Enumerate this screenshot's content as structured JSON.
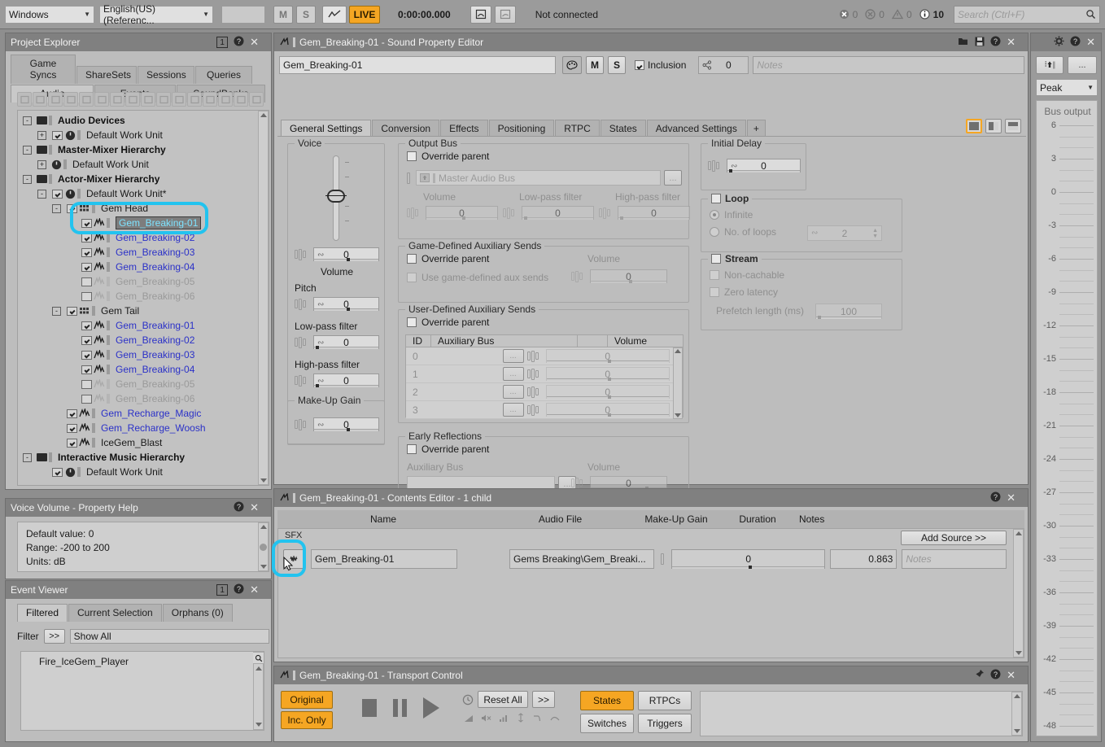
{
  "topbar": {
    "platform": "Windows",
    "language": "English(US) (Referenc...",
    "blank_field": "",
    "mute_label": "M",
    "solo_label": "S",
    "curve_icon": "waveform-icon",
    "live_label": "LIVE",
    "time": "0:00:00.000",
    "connect_icon": "remote-connect-icon",
    "connect_icon2": "remote-connect-alt-icon",
    "connection_status": "Not connected",
    "counters": [
      {
        "icon": "error-icon",
        "value": "0"
      },
      {
        "icon": "critical-icon",
        "value": "0"
      },
      {
        "icon": "warning-icon",
        "value": "0"
      },
      {
        "icon": "info-icon",
        "value": "10"
      }
    ],
    "search_placeholder": "Search (Ctrl+F)",
    "search_icon": "search-icon"
  },
  "project_explorer": {
    "title": "Project Explorer",
    "badge": "1",
    "help_icon": "help-icon",
    "close_icon": "close-icon",
    "tabs_row1": [
      "Game Syncs",
      "ShareSets",
      "Sessions",
      "Queries"
    ],
    "tabs_row2": [
      "Audio",
      "Events",
      "SoundBanks"
    ],
    "selected_tab": "Audio",
    "toolbar_icons": [
      "recent-icon",
      "new-folder-icon",
      "open-folder-icon",
      "mixer-icon",
      "grid-icon",
      "list-icon",
      "blend-icon",
      "random-icon",
      "sound-icon",
      "motion-icon",
      "bus-icon",
      "aux-bus-icon",
      "switch-icon",
      "actor-mixer-icon",
      "music-icon",
      "range-icon"
    ],
    "tree": [
      {
        "indent": 0,
        "expander": "-",
        "check": null,
        "icon": "folder-icon",
        "label": "Audio Devices",
        "style": "bold"
      },
      {
        "indent": 1,
        "expander": "+",
        "check": "on",
        "icon": "device-icon",
        "label": "Default Work Unit",
        "style": "normal"
      },
      {
        "indent": 0,
        "expander": "-",
        "check": null,
        "icon": "folder-icon",
        "label": "Master-Mixer Hierarchy",
        "style": "bold"
      },
      {
        "indent": 1,
        "expander": "+",
        "check": null,
        "icon": "device-icon",
        "label": "Default Work Unit",
        "style": "normal"
      },
      {
        "indent": 0,
        "expander": "-",
        "check": null,
        "icon": "folder-icon",
        "label": "Actor-Mixer Hierarchy",
        "style": "bold"
      },
      {
        "indent": 1,
        "expander": "-",
        "check": "on",
        "icon": "device-icon",
        "label": "Default Work Unit*",
        "style": "normal"
      },
      {
        "indent": 2,
        "expander": "-",
        "check": "on",
        "icon": "actormixer-icon",
        "label": "Gem Head",
        "style": "normal"
      },
      {
        "indent": 3,
        "expander": null,
        "check": "on",
        "icon": "sound-icon",
        "label": "Gem_Breaking-01",
        "style": "selected"
      },
      {
        "indent": 3,
        "expander": null,
        "check": "on",
        "icon": "sound-icon",
        "label": "Gem_Breaking-02",
        "style": "blue"
      },
      {
        "indent": 3,
        "expander": null,
        "check": "on",
        "icon": "sound-icon",
        "label": "Gem_Breaking-03",
        "style": "blue"
      },
      {
        "indent": 3,
        "expander": null,
        "check": "on",
        "icon": "sound-icon",
        "label": "Gem_Breaking-04",
        "style": "blue"
      },
      {
        "indent": 3,
        "expander": null,
        "check": "off",
        "icon": "sound-icon",
        "label": "Gem_Breaking-05",
        "style": "gray"
      },
      {
        "indent": 3,
        "expander": null,
        "check": "off",
        "icon": "sound-icon",
        "label": "Gem_Breaking-06",
        "style": "gray"
      },
      {
        "indent": 2,
        "expander": "-",
        "check": "on",
        "icon": "actormixer-icon",
        "label": "Gem Tail",
        "style": "normal"
      },
      {
        "indent": 3,
        "expander": null,
        "check": "on",
        "icon": "sound-icon",
        "label": "Gem_Breaking-01",
        "style": "blue"
      },
      {
        "indent": 3,
        "expander": null,
        "check": "on",
        "icon": "sound-icon",
        "label": "Gem_Breaking-02",
        "style": "blue"
      },
      {
        "indent": 3,
        "expander": null,
        "check": "on",
        "icon": "sound-icon",
        "label": "Gem_Breaking-03",
        "style": "blue"
      },
      {
        "indent": 3,
        "expander": null,
        "check": "on",
        "icon": "sound-icon",
        "label": "Gem_Breaking-04",
        "style": "blue"
      },
      {
        "indent": 3,
        "expander": null,
        "check": "off",
        "icon": "sound-icon",
        "label": "Gem_Breaking-05",
        "style": "gray"
      },
      {
        "indent": 3,
        "expander": null,
        "check": "off",
        "icon": "sound-icon",
        "label": "Gem_Breaking-06",
        "style": "gray"
      },
      {
        "indent": 2,
        "expander": null,
        "check": "on",
        "icon": "sound-icon",
        "label": "Gem_Recharge_Magic",
        "style": "blue"
      },
      {
        "indent": 2,
        "expander": null,
        "check": "on",
        "icon": "sound-icon",
        "label": "Gem_Recharge_Woosh",
        "style": "blue"
      },
      {
        "indent": 2,
        "expander": null,
        "check": "on",
        "icon": "sound-icon",
        "label": "IceGem_Blast",
        "style": "normal"
      },
      {
        "indent": 0,
        "expander": "-",
        "check": null,
        "icon": "folder-icon",
        "label": "Interactive Music Hierarchy",
        "style": "bold"
      },
      {
        "indent": 1,
        "expander": null,
        "check": "on",
        "icon": "device-icon",
        "label": "Default Work Unit",
        "style": "normal"
      }
    ]
  },
  "property_help": {
    "title": "Voice Volume - Property Help",
    "help_icon": "help-icon",
    "close_icon": "close-icon",
    "lines": [
      "Default value: 0",
      "Range: -200 to 200",
      "Units: dB"
    ]
  },
  "event_viewer": {
    "title": "Event Viewer",
    "badge": "1",
    "help_icon": "help-icon",
    "close_icon": "close-icon",
    "tabs": [
      "Filtered",
      "Current Selection",
      "Orphans (0)"
    ],
    "selected_tab": "Filtered",
    "filter_label": "Filter",
    "filter_more": ">>",
    "filter_value": "Show All",
    "list_items": [
      "Fire_IceGem_Player"
    ],
    "search_icon": "search-icon"
  },
  "sound_property_editor": {
    "title": "Gem_Breaking-01 - Sound Property Editor",
    "object_icon": "sound-icon",
    "titlebar_icons": [
      "open-icon",
      "save-icon",
      "help-icon",
      "close-icon"
    ],
    "name_value": "Gem_Breaking-01",
    "color_icon": "palette-icon",
    "mute_label": "M",
    "solo_label": "S",
    "inclusion_label": "Inclusion",
    "inclusion_checked": true,
    "share_icon": "share-icon",
    "share_count": "0",
    "notes_placeholder": "Notes",
    "tabs": [
      "General Settings",
      "Conversion",
      "Effects",
      "Positioning",
      "RTPC",
      "States",
      "Advanced Settings",
      "+"
    ],
    "selected_tab": "General Settings",
    "layout_buttons": [
      "single-view-icon",
      "split-view-icon",
      "stacked-view-icon"
    ],
    "voice": {
      "group_label": "Voice",
      "fader_value": "0",
      "volume_label": "Volume",
      "volume_value": "0",
      "pitch_label": "Pitch",
      "pitch_value": "0",
      "lowpass_label": "Low-pass filter",
      "lowpass_value": "0",
      "highpass_label": "High-pass filter",
      "highpass_value": "0"
    },
    "makeup_gain": {
      "group_label": "Make-Up Gain",
      "value": "0"
    },
    "output_bus": {
      "group_label": "Output Bus",
      "override_label": "Override parent",
      "override_checked": false,
      "bus_value": "Master Audio Bus",
      "browse_label": "...",
      "volume_label": "Volume",
      "volume_value": "0",
      "lowpass_label": "Low-pass filter",
      "lowpass_value": "0",
      "highpass_label": "High-pass filter",
      "highpass_value": "0"
    },
    "game_aux": {
      "group_label": "Game-Defined Auxiliary Sends",
      "override_label": "Override parent",
      "override_checked": false,
      "use_label": "Use game-defined aux sends",
      "use_checked": false,
      "volume_label": "Volume",
      "volume_value": "0"
    },
    "user_aux": {
      "group_label": "User-Defined Auxiliary Sends",
      "override_label": "Override parent",
      "override_checked": false,
      "columns": [
        "ID",
        "Auxiliary Bus",
        "",
        "Volume"
      ],
      "rows": [
        {
          "id": "0",
          "bus": "",
          "browse": "...",
          "volume": "0"
        },
        {
          "id": "1",
          "bus": "",
          "browse": "...",
          "volume": "0"
        },
        {
          "id": "2",
          "bus": "",
          "browse": "...",
          "volume": "0"
        },
        {
          "id": "3",
          "bus": "",
          "browse": "...",
          "volume": "0"
        }
      ]
    },
    "early_reflections": {
      "group_label": "Early Reflections",
      "override_label": "Override parent",
      "override_checked": false,
      "bus_label": "Auxiliary Bus",
      "bus_value": "",
      "browse_label": "...",
      "volume_label": "Volume",
      "volume_value": "0"
    },
    "initial_delay": {
      "group_label": "Initial Delay",
      "value": "0"
    },
    "loop": {
      "group_label": "Loop",
      "checked": false,
      "infinite_label": "Infinite",
      "infinite_selected": true,
      "noloops_label": "No. of loops",
      "noloops_selected": false,
      "noloops_value": "2"
    },
    "stream": {
      "group_label": "Stream",
      "checked": false,
      "noncachable_label": "Non-cachable",
      "noncachable_checked": false,
      "zerolatency_label": "Zero latency",
      "zerolatency_checked": false,
      "prefetch_label": "Prefetch length (ms)",
      "prefetch_value": "100"
    }
  },
  "right_panel": {
    "bus_icon": "output-bus-icon",
    "more_label": "...",
    "meter_mode": "Peak",
    "dropdown_icon": "chevron-down-icon",
    "meter_title": "Bus output",
    "meter_ticks": [
      6,
      3,
      0,
      -3,
      -6,
      -9,
      -12,
      -15,
      -18,
      -21,
      -24,
      -27,
      -30,
      -33,
      -36,
      -39,
      -42,
      -45,
      -48
    ],
    "settings_icons": [
      "gear-icon",
      "help-icon",
      "close-icon"
    ],
    "dock_icons": [
      "dock-icon",
      "more-icon"
    ]
  },
  "contents_editor": {
    "title": "Gem_Breaking-01 - Contents Editor - 1 child",
    "object_icon": "sound-icon",
    "help_icon": "help-icon",
    "close_icon": "close-icon",
    "columns": [
      "Name",
      "Audio File",
      "Make-Up Gain",
      "Duration",
      "Notes"
    ],
    "group_label": "SFX",
    "add_source_label": "Add Source >>",
    "rows": [
      {
        "play_icon": "play-source-icon",
        "name": "Gem_Breaking-01",
        "audio_file": "Gems Breaking\\Gem_Breaki...",
        "makeup_gain": "0",
        "duration": "0.863",
        "notes_placeholder": "Notes"
      }
    ]
  },
  "transport_control": {
    "title": "Gem_Breaking-01 - Transport Control",
    "object_icon": "sound-icon",
    "pin_icon": "pin-icon",
    "help_icon": "help-icon",
    "close_icon": "close-icon",
    "original_label": "Original",
    "inc_only_label": "Inc. Only",
    "stop_icon": "stop-icon",
    "pause_icon": "pause-icon",
    "play_icon": "play-icon",
    "clock_icon": "clock-icon",
    "reset_all_label": "Reset All",
    "more_label": ">>",
    "sub_icons": [
      "fade-icon",
      "mute-icon",
      "attenuation-icon",
      "pitch-icon",
      "lpf-icon",
      "hpf-icon"
    ],
    "buttons": [
      {
        "label": "States",
        "active": true
      },
      {
        "label": "RTPCs",
        "active": false
      },
      {
        "label": "Switches",
        "active": false
      },
      {
        "label": "Triggers",
        "active": false
      }
    ]
  },
  "colors": {
    "accent_orange": "#f5a623",
    "highlight_cyan": "#22c3ef",
    "link_blue": "#2b31c8",
    "panel_bg": "#bdbdbd",
    "titlebar": "#808080"
  }
}
